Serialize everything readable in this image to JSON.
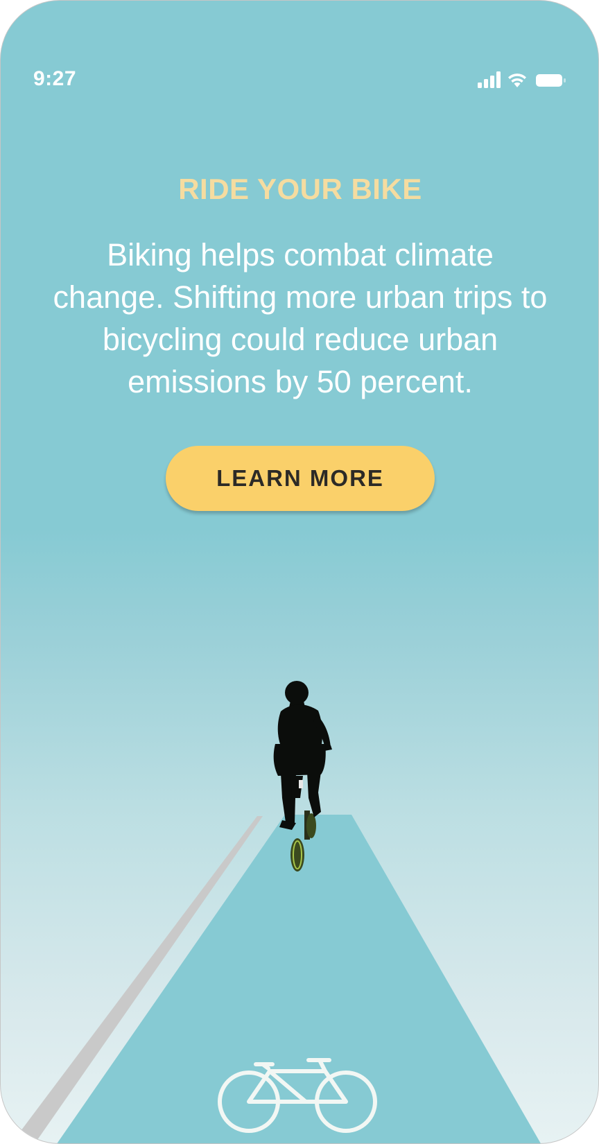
{
  "status_bar": {
    "time": "9:27",
    "icons": [
      "cellular-signal-icon",
      "wifi-icon",
      "battery-icon"
    ]
  },
  "content": {
    "headline": "RIDE YOUR BIKE",
    "body": "Biking helps combat climate change. Shifting more urban trips to bicycling could reduce urban emissions by 50 percent.",
    "button_label": "LEARN MORE"
  },
  "colors": {
    "background": "#86cad3",
    "headline": "#f5dca0",
    "button": "#fad06a",
    "button_text": "#2c2a26",
    "road": "#86cad3",
    "side_line": "#c9c9c9"
  },
  "illustration": {
    "subject": "cyclist-riding-on-bike-lane",
    "lane_marking": "bicycle-symbol-icon"
  }
}
